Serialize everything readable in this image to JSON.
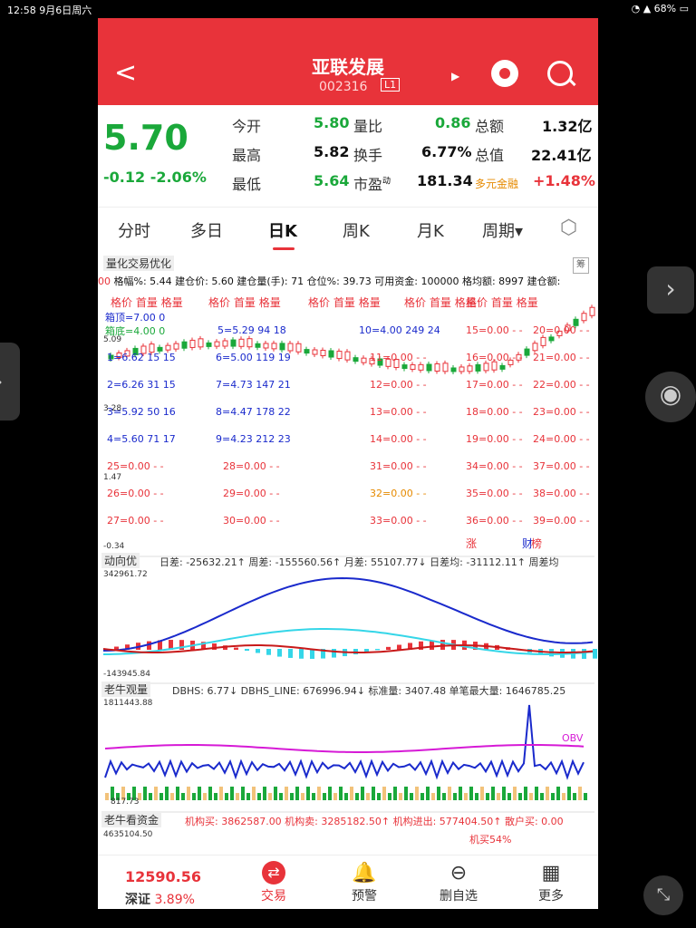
{
  "status": {
    "time": "12:58",
    "date": "9月6日周六",
    "battery": "68%"
  },
  "header": {
    "title": "亚联发展",
    "code": "002316",
    "level": "L1",
    "back": "<"
  },
  "quote": {
    "price": "5.70",
    "change": "-0.12",
    "change_pct": "-2.06%",
    "items": [
      {
        "label": "今开",
        "value": "5.80"
      },
      {
        "label": "最高",
        "value": "5.82"
      },
      {
        "label": "最低",
        "value": "5.64"
      },
      {
        "label": "量比",
        "value": "0.86"
      },
      {
        "label": "换手",
        "value": "6.77%"
      },
      {
        "label": "市盈",
        "sup": "动",
        "value": "181.34"
      },
      {
        "label": "总额",
        "value": "1.32亿"
      },
      {
        "label": "总值",
        "value": "22.41亿"
      },
      {
        "label": "多元金融",
        "value": "+1.48%"
      }
    ]
  },
  "tabs": [
    "分时",
    "多日",
    "日K",
    "周K",
    "月K",
    "周期▾"
  ],
  "chart": {
    "selector": "量化交易优化",
    "fuhao": "筹",
    "info_line": "格幅%: 5.44 建仓价: 5.60 建仓量(手): 71 仓位%: 39.73 可用资金: 100000 格均额: 8997 建仓额:",
    "col_header": [
      "格价",
      "首量",
      "格量"
    ],
    "box_top": "箱顶=7.00 0",
    "box_bottom": "箱底=4.00 0",
    "axis_vals": [
      "5.09",
      "3.28",
      "1.47",
      "-0.34"
    ],
    "grid_blue": [
      "1=6.62 15 15",
      "2=6.26 31 15",
      "3=5.92 50 16",
      "4=5.60 71 17",
      "5=5.29 94 18",
      "6=5.00 119 19",
      "7=4.73 147 21",
      "8=4.47 178 22",
      "9=4.23 212 23",
      "10=4.00 249 24"
    ],
    "grid_red": [
      "11=0.00 - -",
      "12=0.00 - -",
      "13=0.00 - -",
      "14=0.00 - -",
      "15=0.00 - -",
      "16=0.00 - -",
      "17=0.00 - -",
      "18=0.00 - -",
      "19=0.00 - -",
      "20=0.00 - -",
      "21=0.00 - -",
      "22=0.00 - -",
      "23=0.00 - -",
      "24=0.00 - -",
      "25=0.00 - -",
      "26=0.00 - -",
      "27=0.00 - -",
      "28=0.00 - -",
      "29=0.00 - -",
      "30=0.00 - -",
      "31=0.00 - -",
      "33=0.00 - -",
      "34=0.00 - -",
      "35=0.00 - -",
      "36=0.00 - -",
      "37=0.00 - -",
      "38=0.00 - -",
      "39=0.00 - -"
    ],
    "grid_orange": "32=0.00 - -",
    "zhang": "涨",
    "cai": "财",
    "bang": "榜"
  },
  "indicator1": {
    "label": "动向优",
    "line": "日差: -25632.21↑ 周差: -155560.56↑ 月差: 55107.77↓ 日差均: -31112.11↑ 周差均",
    "max": "342961.72",
    "min": "-143945.84"
  },
  "indicator2": {
    "label": "老牛观量",
    "line": "DBHS: 6.77↓ DBHS_LINE: 676996.94↓ 标准量: 3407.48 单笔最大量: 1646785.25",
    "max": "1811443.88",
    "min": "817.73",
    "obv": "OBV"
  },
  "indicator3": {
    "label": "老牛看资金",
    "line": "机构买: 3862587.00 机构卖: 3285182.50↑ 机构进出: 577404.50↑ 散户买: 0.00",
    "max": "4635104.50",
    "jimai": "机买54%"
  },
  "bottom": {
    "index_value": "12590.56",
    "index_name": "深证",
    "index_pct": "3.89%",
    "buttons": [
      "交易",
      "预警",
      "删自选",
      "更多"
    ]
  }
}
